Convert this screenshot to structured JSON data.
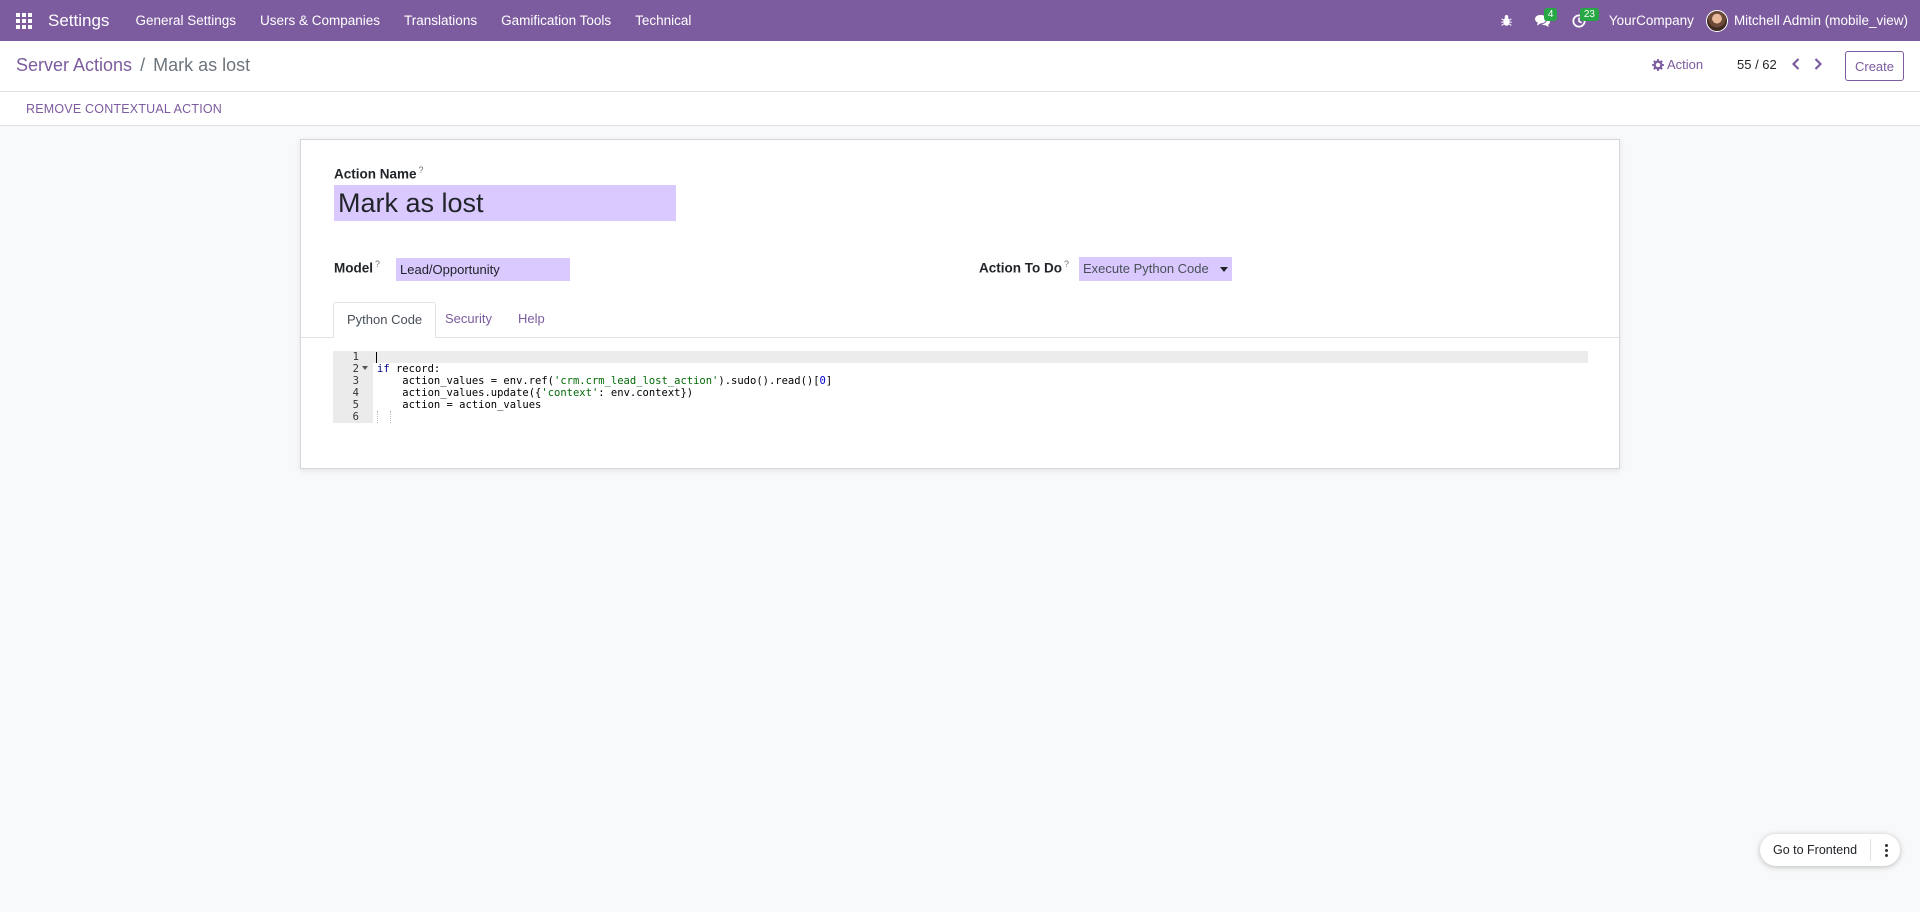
{
  "navbar": {
    "app_name": "Settings",
    "menus": [
      "General Settings",
      "Users & Companies",
      "Translations",
      "Gamification Tools",
      "Technical"
    ],
    "messages_count": "4",
    "activities_count": "23",
    "company": "YourCompany",
    "user": "Mitchell Admin (mobile_view)"
  },
  "control": {
    "breadcrumb_parent": "Server Actions",
    "breadcrumb_sep": "/",
    "breadcrumb_current": "Mark as lost",
    "action_label": "Action",
    "pager": "55 / 62",
    "create_label": "Create"
  },
  "statusbar": {
    "remove_label": "REMOVE CONTEXTUAL ACTION"
  },
  "form": {
    "name_label": "Action Name",
    "name_value": "Mark as lost",
    "model_label": "Model",
    "model_value": "Lead/Opportunity",
    "action_label": "Action To Do",
    "action_value": "Execute Python Code",
    "help_mark": "?",
    "tabs": [
      "Python Code",
      "Security",
      "Help"
    ]
  },
  "code": {
    "line_numbers": [
      "1",
      "2",
      "3",
      "4",
      "5",
      "6"
    ],
    "lines": [
      "",
      "if record:",
      "    action_values = env.ref('crm.crm_lead_lost_action').sudo().read()[0]",
      "    action_values.update({'context': env.context})",
      "    action = action_values",
      ""
    ]
  },
  "frontend": {
    "label": "Go to Frontend"
  },
  "colors": {
    "brand": "#7c5b9e",
    "badge": "#28a745",
    "required_field": "#d9c9ff"
  }
}
